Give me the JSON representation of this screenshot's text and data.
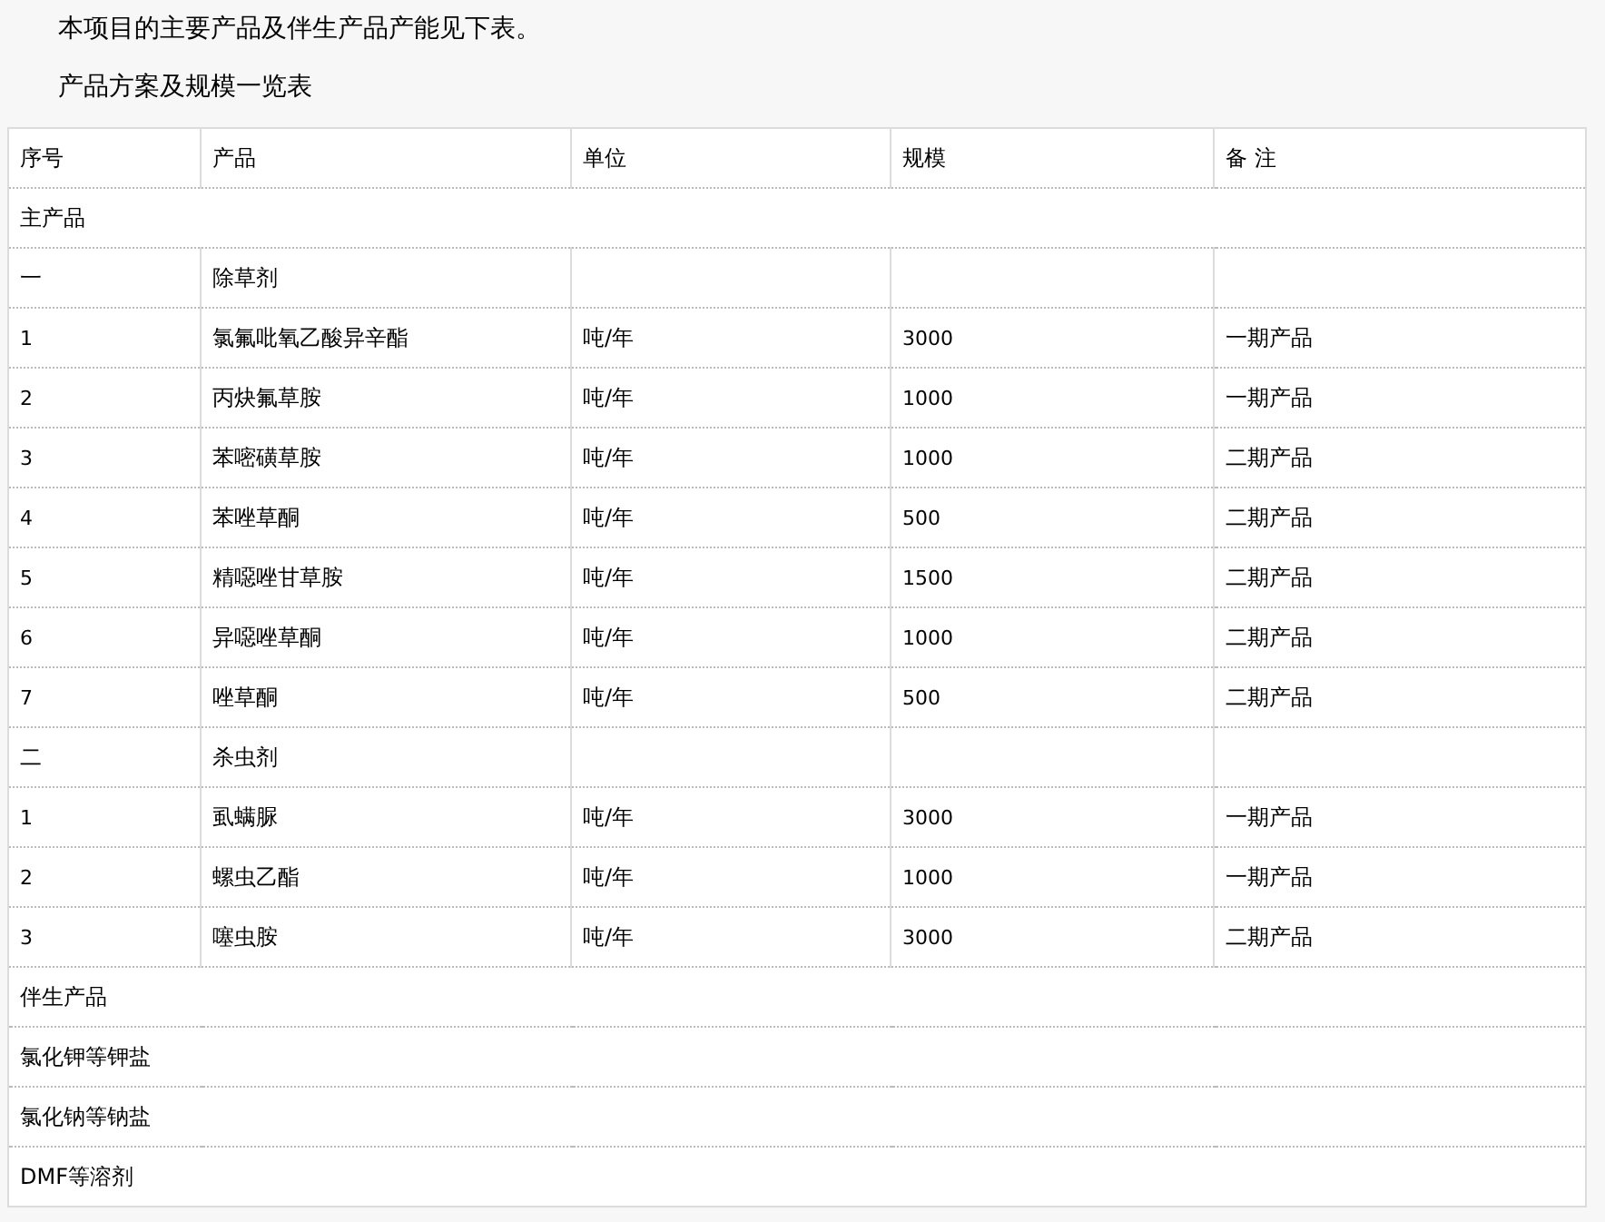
{
  "paragraphs": [
    "本项目的主要产品及伴生产品产能见下表。",
    "产品方案及规模一览表"
  ],
  "table": {
    "columns": [
      "序号",
      "产品",
      "单位",
      "规模",
      "备 注"
    ],
    "rows": [
      {
        "kind": "span",
        "text": "主产品"
      },
      {
        "kind": "cells",
        "cells": [
          "一",
          "除草剂"
        ]
      },
      {
        "kind": "cells",
        "cells": [
          "1",
          "氯氟吡氧乙酸异辛酯",
          "吨/年",
          "3000",
          "一期产品"
        ]
      },
      {
        "kind": "cells",
        "cells": [
          "2",
          "丙炔氟草胺",
          "吨/年",
          "1000",
          "一期产品"
        ]
      },
      {
        "kind": "cells",
        "cells": [
          "3",
          "苯嘧磺草胺",
          "吨/年",
          "1000",
          "二期产品"
        ]
      },
      {
        "kind": "cells",
        "cells": [
          "4",
          "苯唑草酮",
          "吨/年",
          "500",
          "二期产品"
        ]
      },
      {
        "kind": "cells",
        "cells": [
          "5",
          "精噁唑甘草胺",
          "吨/年",
          "1500",
          "二期产品"
        ]
      },
      {
        "kind": "cells",
        "cells": [
          "6",
          "异噁唑草酮",
          "吨/年",
          "1000",
          "二期产品"
        ]
      },
      {
        "kind": "cells",
        "cells": [
          "7",
          "唑草酮",
          "吨/年",
          "500",
          "二期产品"
        ]
      },
      {
        "kind": "cells",
        "cells": [
          "二",
          "杀虫剂"
        ]
      },
      {
        "kind": "cells",
        "cells": [
          "1",
          "虱螨脲",
          "吨/年",
          "3000",
          "一期产品"
        ]
      },
      {
        "kind": "cells",
        "cells": [
          "2",
          "螺虫乙酯",
          "吨/年",
          "1000",
          "一期产品"
        ]
      },
      {
        "kind": "cells",
        "cells": [
          "3",
          "噻虫胺",
          "吨/年",
          "3000",
          "二期产品"
        ]
      },
      {
        "kind": "span",
        "text": "伴生产品"
      },
      {
        "kind": "span",
        "text": "氯化钾等钾盐"
      },
      {
        "kind": "span",
        "text": "氯化钠等钠盐"
      },
      {
        "kind": "span",
        "text": "DMF等溶剂"
      }
    ]
  }
}
